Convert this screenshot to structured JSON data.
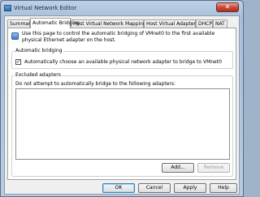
{
  "window": {
    "title": "Virtual Network Editor",
    "close_glyph": "✕"
  },
  "tabs": [
    {
      "label": "Summary"
    },
    {
      "label": "Automatic Bridging"
    },
    {
      "label": "Host Virtual Network Mapping"
    },
    {
      "label": "Host Virtual Adapters"
    },
    {
      "label": "DHCP"
    },
    {
      "label": "NAT"
    }
  ],
  "info": {
    "text": "Use this page to control the automatic bridging of VMnet0 to the first available physical Ethernet adapter on the host."
  },
  "automatic_bridging": {
    "label": "Automatic bridging",
    "checkbox_label": "Automatically choose an available physical network adapter to bridge to VMnet0",
    "checked_glyph": "✓"
  },
  "excluded_adapters": {
    "label": "Excluded adapters",
    "description": "Do not attempt to automatically bridge to the following adapters:",
    "add_label": "Add...",
    "remove_label": "Remove"
  },
  "footer": {
    "ok_label": "OK",
    "cancel_label": "Cancel",
    "apply_label": "Apply",
    "help_label": "Help"
  }
}
